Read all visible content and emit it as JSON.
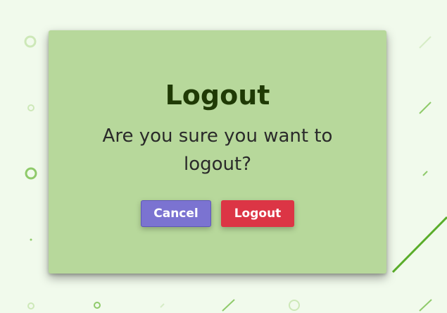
{
  "dialog": {
    "title": "Logout",
    "message": "Are you sure you want to logout?",
    "cancel_label": "Cancel",
    "confirm_label": "Logout"
  },
  "colors": {
    "page_background": "#f1faec",
    "dialog_background": "#b7d89b",
    "title_text": "#1f3a05",
    "cancel_button": "#7b73d1",
    "logout_button": "#dc3545",
    "decor_accent": "#5aad2a"
  }
}
